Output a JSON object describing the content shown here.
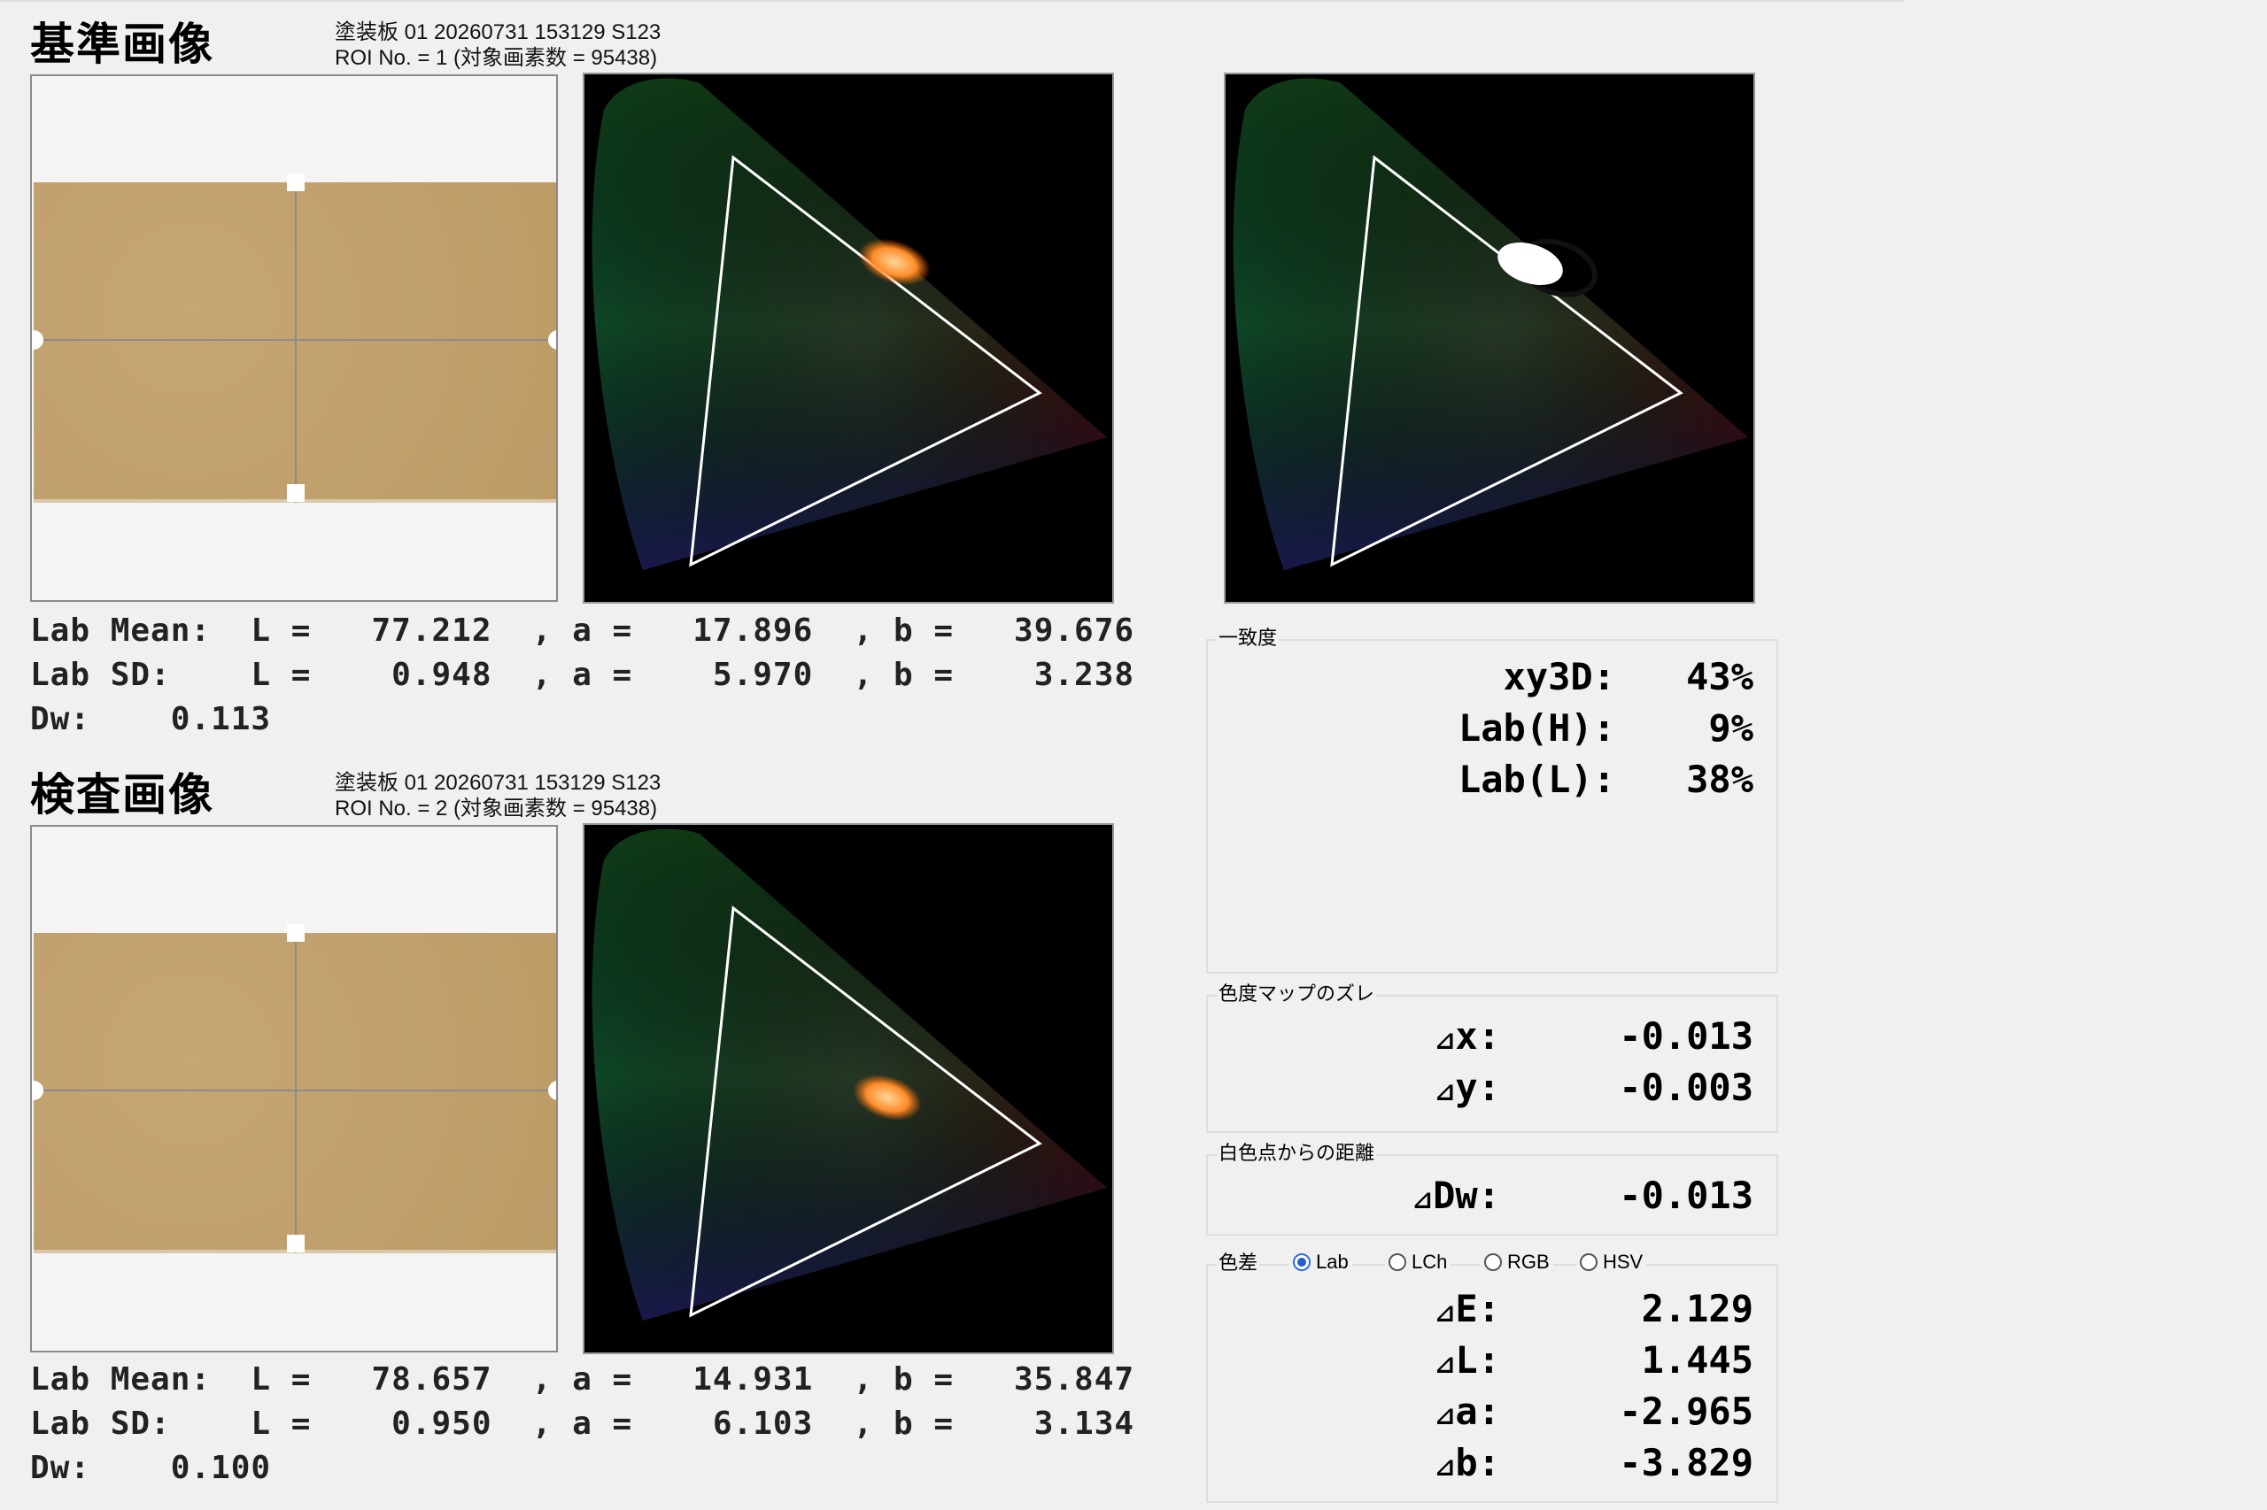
{
  "reference": {
    "title": "基準画像",
    "meta_line1": "塗装板  01  20260731  153129  S123",
    "meta_line2": "ROI No. = 1 (対象画素数 = 95438)",
    "lab_mean": "Lab Mean:  L =   77.212  , a =   17.896  , b =   39.676",
    "lab_sd": "Lab SD:    L =    0.948  , a =    5.970  , b =    3.238",
    "dw": "Dw:    0.113"
  },
  "inspection": {
    "title": "検査画像",
    "meta_line1": "塗装板  01  20260731  153129  S123",
    "meta_line2": "ROI No. = 2 (対象画素数 = 95438)",
    "lab_mean": "Lab Mean:  L =   78.657  , a =   14.931  , b =   35.847",
    "lab_sd": "Lab SD:    L =    0.950  , a =    6.103  , b =    3.134",
    "dw": "Dw:    0.100"
  },
  "match": {
    "label": "一致度",
    "xy3d_label": "xy3D:",
    "xy3d_value": "43%",
    "labh_label": "Lab(H):",
    "labh_value": "9%",
    "labl_label": "Lab(L):",
    "labl_value": "38%"
  },
  "shift": {
    "label": "色度マップのズレ",
    "dx_label": "x:",
    "dx_value": "-0.013",
    "dy_label": "y:",
    "dy_value": "-0.003"
  },
  "white_dist": {
    "label": "白色点からの距離",
    "dw_label": "Dw:",
    "dw_value": "-0.013"
  },
  "color_diff": {
    "label": "色差",
    "modes": [
      "Lab",
      "LCh",
      "RGB",
      "HSV"
    ],
    "selected": "Lab",
    "de_label": "E:",
    "de_value": "2.129",
    "dl_label": "L:",
    "dl_value": "1.445",
    "da_label": "a:",
    "da_value": "-2.965",
    "db_label": "b:",
    "db_value": "-3.829"
  },
  "delta_symbol": "⊿",
  "colors": {
    "sample": "#c2a06a",
    "triangle": "#ffffff",
    "blob_ref": "#ff9a3c",
    "blob_mask": "#ffffff"
  }
}
